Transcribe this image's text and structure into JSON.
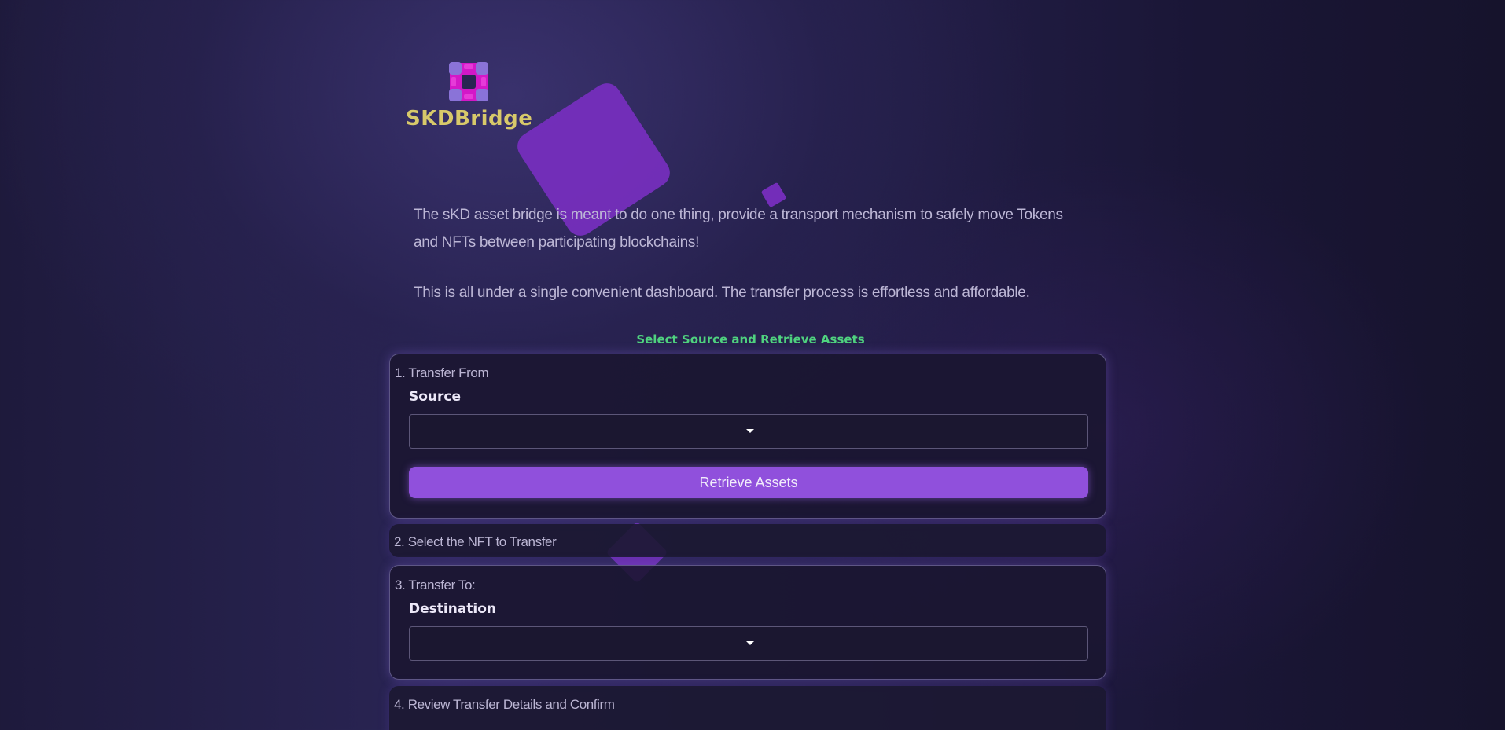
{
  "brand": {
    "name": "SKDBridge",
    "logo_icon": "interlocking-square-ring-icon"
  },
  "intro": {
    "paragraph1": "The sKD asset bridge is meant to do one thing, provide a transport mechanism to safely move Tokens and NFTs between participating blockchains!",
    "paragraph2": "This is all under a single convenient dashboard. The transfer process is effortless and affordable."
  },
  "section_heading": "Select Source and Retrieve Assets",
  "steps": {
    "transfer_from": {
      "title": "1. Transfer From",
      "field_label": "Source",
      "select_value": "",
      "button_label": "Retrieve Assets"
    },
    "select_nft": {
      "title": "2. Select the NFT to Transfer"
    },
    "transfer_to": {
      "title": "3. Transfer To:",
      "field_label": "Destination",
      "select_value": ""
    },
    "review": {
      "title": "4. Review Transfer Details and Confirm"
    }
  },
  "colors": {
    "accent_purple": "#9050dc",
    "heading_green": "#4fd27f",
    "brand_yellow": "#d8c96a",
    "logo_magenta": "#d318c8",
    "logo_lavender": "#8a73d8"
  }
}
